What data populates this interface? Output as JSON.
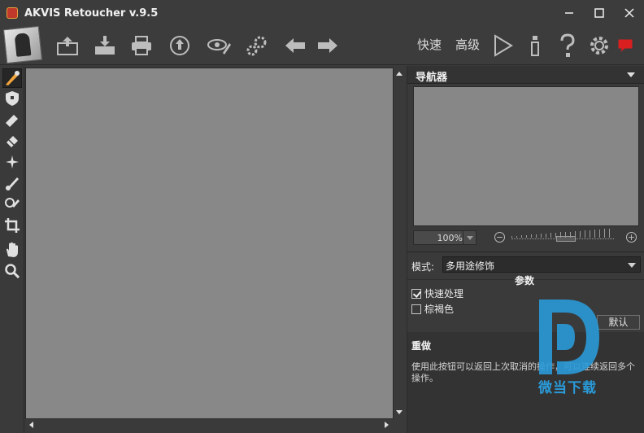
{
  "window": {
    "title": "AKVIS Retoucher v.9.5",
    "controls": [
      "minimize-icon",
      "maximize-icon",
      "close-icon"
    ]
  },
  "toolbar": {
    "icons": [
      "open-image-icon",
      "save-image-icon",
      "print-icon",
      "share-icon",
      "batch-processing-icon",
      "preferences-icon",
      "undo-icon",
      "redo-icon"
    ],
    "mode_quick": "快速",
    "mode_advanced": "高级",
    "right_icons": [
      "run-icon",
      "info-icon",
      "help-icon",
      "settings-icon",
      "news-icon"
    ]
  },
  "tools": [
    "retouch-brush-tool",
    "mask-tool",
    "eraser-tool",
    "bandage-tool",
    "magic-wand-tool",
    "brush-tool",
    "clone-stamp-tool",
    "crop-tool",
    "hand-tool",
    "zoom-tool"
  ],
  "navigator": {
    "title": "导航器",
    "zoom": "100%"
  },
  "settings": {
    "mode_label": "模式:",
    "mode_value": "多用途修饰",
    "params_title": "参数",
    "fast_processing_label": "快速处理",
    "fast_processing_checked": true,
    "sepia_label": "棕褐色",
    "sepia_checked": false,
    "default_button": "默认"
  },
  "info": {
    "title": "重做",
    "text": "使用此按钮可以返回上次取消的操作，可以连续返回多个操作。"
  },
  "watermark": {
    "text": "微当下载"
  },
  "colors": {
    "background": "#3a3a3a",
    "canvas": "#888888",
    "watermark": "#2a9ad8"
  }
}
